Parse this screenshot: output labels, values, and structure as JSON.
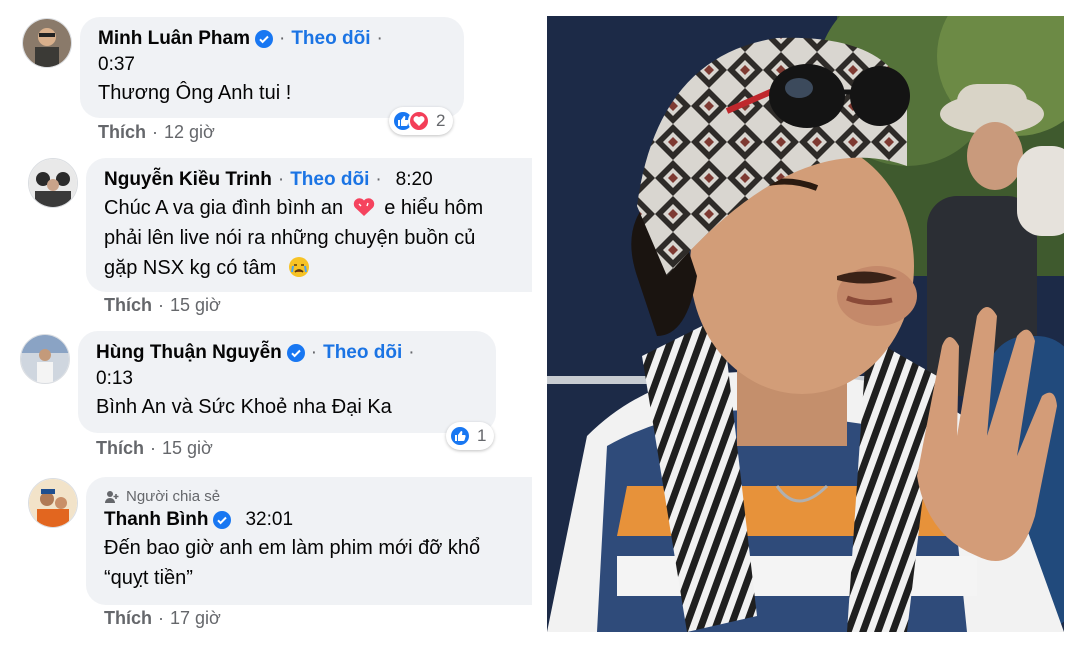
{
  "comments": [
    {
      "name": "Minh Luân Pham",
      "verified": true,
      "follow": "Theo dõi",
      "timestamp": "0:37",
      "text": "Thương Ông Anh tui !",
      "like_label": "Thích",
      "age": "12 giờ",
      "reaction_count": "2",
      "reactions": [
        "like-icon",
        "love-icon"
      ]
    },
    {
      "name": "Nguyễn Kiều Trinh",
      "verified": false,
      "follow": "Theo dõi",
      "timestamp": "8:20",
      "text_lines": [
        "Chúc A va gia đình bình an",
        "e hiểu hôm",
        "phải lên live nói ra những chuyện buồn củ",
        "gặp NSX kg có tâm"
      ],
      "emoji": [
        "heart-emoji",
        "crying-face-emoji"
      ],
      "like_label": "Thích",
      "age": "15 giờ"
    },
    {
      "name": "Hùng Thuận Nguyễn",
      "verified": true,
      "follow": "Theo dõi",
      "timestamp": "0:13",
      "text": "Bình An và Sức Khoẻ nha Đại Ka",
      "like_label": "Thích",
      "age": "15 giờ",
      "reaction_count": "1",
      "reactions": [
        "like-icon"
      ]
    },
    {
      "shared_label": "Người chia sẻ",
      "name": "Thanh Bình",
      "verified": true,
      "timestamp": "32:01",
      "text_lines": [
        "Đến bao giờ anh em làm phim mới đỡ khổ",
        "“quỵt tiền”"
      ],
      "like_label": "Thích",
      "age": "17 giờ"
    }
  ],
  "colors": {
    "bubble": "#f0f2f5",
    "link": "#1b74e4",
    "meta": "#65676b",
    "like_blue": "#1877f2",
    "love_red": "#f33e58"
  },
  "photo": {
    "subject": "man-in-knit-hat-with-sunglasses-photo"
  }
}
